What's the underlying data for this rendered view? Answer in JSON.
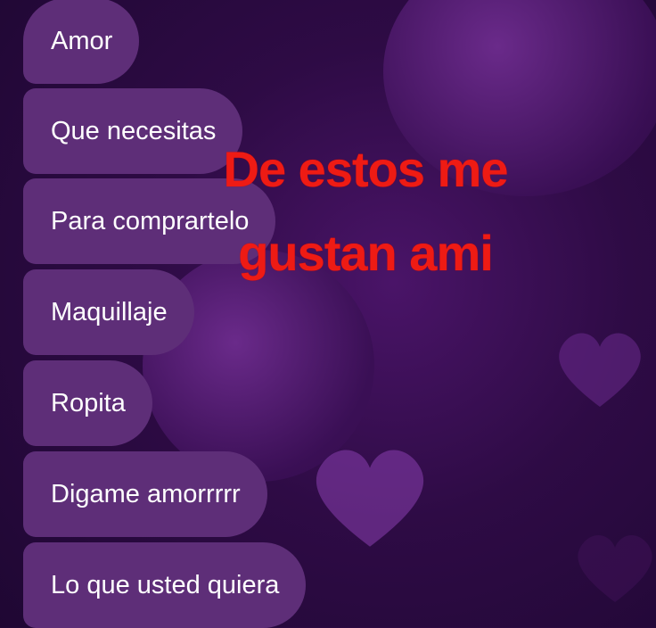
{
  "messages": [
    {
      "text": "Amor"
    },
    {
      "text": "Que necesitas"
    },
    {
      "text": "Para comprartelo"
    },
    {
      "text": "Maquillaje"
    },
    {
      "text": "Ropita"
    },
    {
      "text": "Digame amorrrrr"
    },
    {
      "text": "Lo que usted quiera"
    }
  ],
  "overlay": {
    "line1": "De estos me",
    "line2": "gustan ami",
    "color": "#ee1b14"
  },
  "colors": {
    "bubble": "#5e2e78",
    "background": "#2e0b45"
  }
}
